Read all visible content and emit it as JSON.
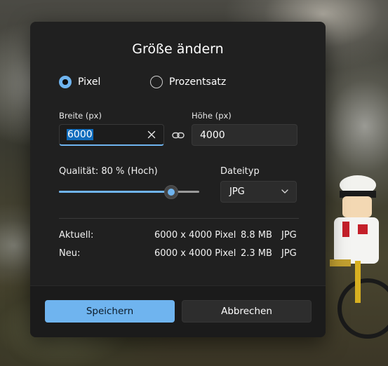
{
  "dialog": {
    "title": "Größe ändern",
    "mode_options": [
      {
        "label": "Pixel",
        "selected": true
      },
      {
        "label": "Prozentsatz",
        "selected": false
      }
    ],
    "width": {
      "label": "Breite (px)",
      "value": "6000"
    },
    "height": {
      "label": "Höhe (px)",
      "value": "4000"
    },
    "quality": {
      "label": "Qualität: 80 % (Hoch)",
      "percent": 80
    },
    "filetype": {
      "label": "Dateityp",
      "selected": "JPG"
    },
    "current": {
      "label": "Aktuell:",
      "dimensions": "6000 x 4000 Pixel",
      "size": "8.8 MB",
      "format": "JPG"
    },
    "new": {
      "label": "Neu:",
      "dimensions": "6000 x 4000 Pixel",
      "size": "2.3 MB",
      "format": "JPG"
    },
    "save_label": "Speichern",
    "cancel_label": "Abbrechen"
  },
  "colors": {
    "accent": "#6fb4ef",
    "dialog_bg": "#202020",
    "footer_bg": "#1b1b1b"
  },
  "icons": {
    "clear": "close-icon",
    "link": "link-icon",
    "dropdown": "chevron-down-icon"
  }
}
